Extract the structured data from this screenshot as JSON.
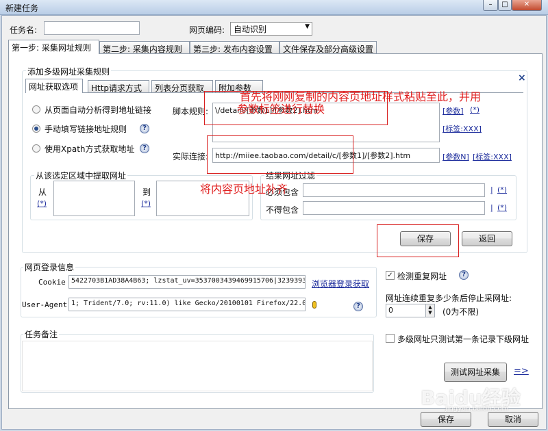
{
  "window": {
    "title": "新建任务",
    "min": "–",
    "max": "□",
    "close": "✕"
  },
  "header": {
    "task_name_label": "任务名:",
    "task_name_value": "",
    "encoding_label": "网页编码:",
    "encoding_value": "自动识别"
  },
  "tabs": [
    "第一步: 采集网址规则",
    "第二步: 采集内容规则",
    "第三步: 发布内容设置",
    "文件保存及部分高级设置"
  ],
  "rules": {
    "group_title": "添加多级网址采集规则",
    "close": "×",
    "subtabs": [
      "网址获取选项",
      "Http请求方式",
      "列表分页获取",
      "附加参数"
    ],
    "options": [
      {
        "label": "从页面自动分析得到地址链接",
        "selected": false
      },
      {
        "label": "手动填写链接地址规则",
        "selected": true
      },
      {
        "label": "使用Xpath方式获取地址",
        "selected": false
      }
    ],
    "script_label": "脚本规则:",
    "script_value": "\\/detail\\/[参数1]/[参数2].htm",
    "param_link": "[参数]",
    "star_link": "(*)",
    "tag_link": "[标签:XXX]",
    "actual_label": "实际连接:",
    "actual_value": "http://miiee.taobao.com/detail/c/[参数1]/[参数2].htm",
    "paramN_link": "[参数N]",
    "tag_link2": "[标签:XXX]",
    "extract_title": "从该选定区域中提取网址",
    "from_label": "从",
    "to_label": "到",
    "star1": "(*)",
    "star2": "(*)",
    "filter_title": "结果网址过滤",
    "must_label": "必须包含",
    "mustnot_label": "不得包含",
    "bar1": "|",
    "bar2": "|",
    "fstar1": "(*)",
    "fstar2": "(*)",
    "save_btn": "保存",
    "back_btn": "返回"
  },
  "annotations": {
    "a1_line1": "首先将刚刚复制的内容页地址样式粘贴至此，并用",
    "a1_line2": "参数标签进行替换",
    "a2": "将内容页地址补齐"
  },
  "login": {
    "title": "网页登录信息",
    "cookie_label": "Cookie",
    "cookie_value": "5422703B1AD38A4B63; lzstat_uv=3537003439469915706|3239393",
    "browser_link": "浏览器登录获取",
    "ua_label": "User-Agent",
    "ua_value": "1; Trident/7.0; rv:11.0) like Gecko/20100101 Firefox/22.0"
  },
  "right": {
    "dup_label": "检测重复网址",
    "dup_checked": true,
    "stop_label": "网址连续重复多少条后停止采网址:",
    "stop_value": "0",
    "stop_note": "(0为不限)",
    "first_label": "多级网址只测试第一条记录下级网址",
    "first_checked": false,
    "test_btn": "测试网址采集",
    "arrow": "=>"
  },
  "notes": {
    "title": "任务备注"
  },
  "footer": {
    "save": "保存",
    "cancel": "取消"
  },
  "watermark": {
    "text": "Baidu经验",
    "sub": "jingyan.baidu.com"
  },
  "icons": {
    "help": "question-circle-icon",
    "bulb": "bulb-icon"
  }
}
